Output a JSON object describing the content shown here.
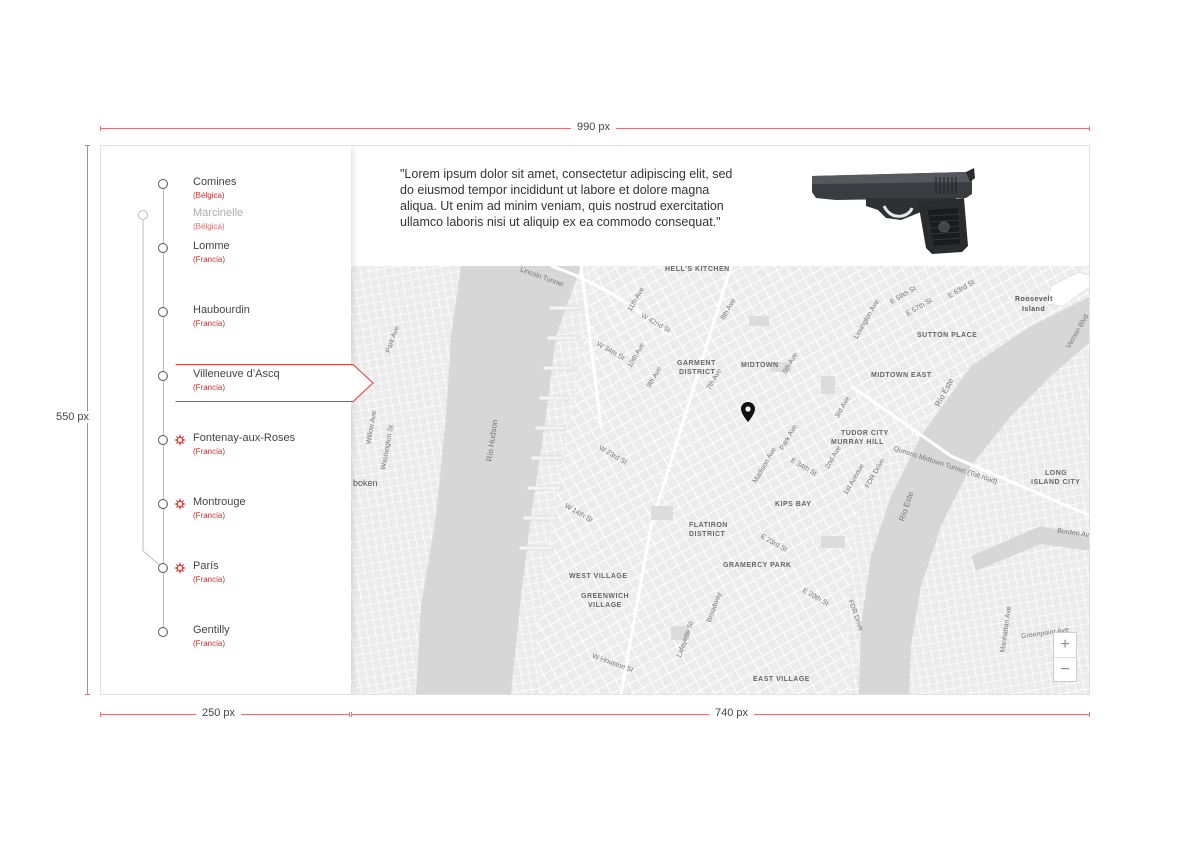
{
  "dimensions": {
    "total_width": "990 px",
    "height": "550 px",
    "sidebar_width": "250 px",
    "main_width": "740 px"
  },
  "timeline": [
    {
      "name": "Comines",
      "country": "(Bélgica)",
      "state": "normal",
      "event": false
    },
    {
      "name": "Marcinelle",
      "country": "(Bélgica)",
      "state": "faded",
      "event": false
    },
    {
      "name": "Lomme",
      "country": "(Francia)",
      "state": "normal",
      "event": false
    },
    {
      "name": "Haubourdin",
      "country": "(Francia)",
      "state": "normal",
      "event": false
    },
    {
      "name": "Villeneuve d’Ascq",
      "country": "(Francia)",
      "state": "selected",
      "event": false
    },
    {
      "name": "Fontenay-aux-Roses",
      "country": "(Francia)",
      "state": "normal",
      "event": true
    },
    {
      "name": "Montrouge",
      "country": "(Francia)",
      "state": "normal",
      "event": true
    },
    {
      "name": "París",
      "country": "(Francia)",
      "state": "normal",
      "event": true
    },
    {
      "name": "Gentilly",
      "country": "(Francia)",
      "state": "normal",
      "event": false
    }
  ],
  "quote": {
    "text": "\"Lorem ipsum dolor sit amet, consectetur adipiscing elit, sed do eiusmod tempor incididunt ut labore et dolore magna aliqua. Ut enim ad minim veniam, quis nostrud exercitation ullamco laboris nisi ut aliquip ex ea commodo consequat.\"",
    "image": "pistol-image"
  },
  "map": {
    "labels": {
      "hells_kitchen": "HELL'S KITCHEN",
      "garment": "GARMENT",
      "district": "DISTRICT",
      "midtown": "MIDTOWN",
      "midtown_east": "MIDTOWN EAST",
      "sutton_place": "SUTTON PLACE",
      "roosevelt": "Roosevelt",
      "island": "Island",
      "tudor_city": "TUDOR CITY",
      "murray_hill": "MURRAY HILL",
      "kips_bay": "KIPS BAY",
      "flatiron": "FLATIRON",
      "flatiron_district": "DISTRICT",
      "gramercy_park": "GRAMERCY PARK",
      "west_village": "WEST VILLAGE",
      "greenwich": "GREENWICH",
      "village": "VILLAGE",
      "east_village": "EAST VILLAGE",
      "long": "LONG",
      "island_city": "ISLAND CITY",
      "rio_hudson": "Río Hudson",
      "rio_este": "Río Este",
      "rio_este_2": "Río Este",
      "lincoln_tunnel": "Lincoln Tunnel",
      "queens_tunnel": "Queens Midtown Tunnel (Toll road)",
      "fdr_drive": "FDR Drive",
      "fdr_drive_2": "FDR Drive",
      "w_42nd": "W 42nd St",
      "w_34th": "W 34th St",
      "w_23rd": "W 23rd St",
      "w_14th": "W 14th St",
      "e_34th": "E 34th St",
      "e_23rd": "E 23rd St",
      "e_20th": "E 20th St",
      "fifth_ave": "5th Ave",
      "seventh_ave": "7th Ave",
      "eighth_ave": "8th Ave",
      "ninth_ave": "9th Ave",
      "tenth_ave": "10th Ave",
      "eleventh_ave": "11th Ave",
      "park_ave": "Park Ave",
      "third_ave": "3rd Ave",
      "second_ave": "2nd Ave",
      "first_ave": "1st Avenue",
      "madison_ave": "Madison Ave",
      "broadway": "Broadway",
      "lexington": "Lexington Ave",
      "hoboken": "boken",
      "washington_st": "Washington St",
      "willow_ave": "Willow Ave",
      "park_ave_nj": "Park Ave",
      "w_houston": "W Houston St",
      "lafayette": "Lafayette St",
      "greenpoint": "Greenpoint Ave",
      "manhattan_ave": "Manhattan Ave",
      "borden": "Borden Ave",
      "vernon": "Vernon Blvd",
      "e_59th": "E 59th St",
      "e_57th": "E 57th St",
      "e_63rd": "E 63rd St"
    },
    "zoom_in": "+",
    "zoom_out": "−",
    "marker": "location-pin"
  }
}
